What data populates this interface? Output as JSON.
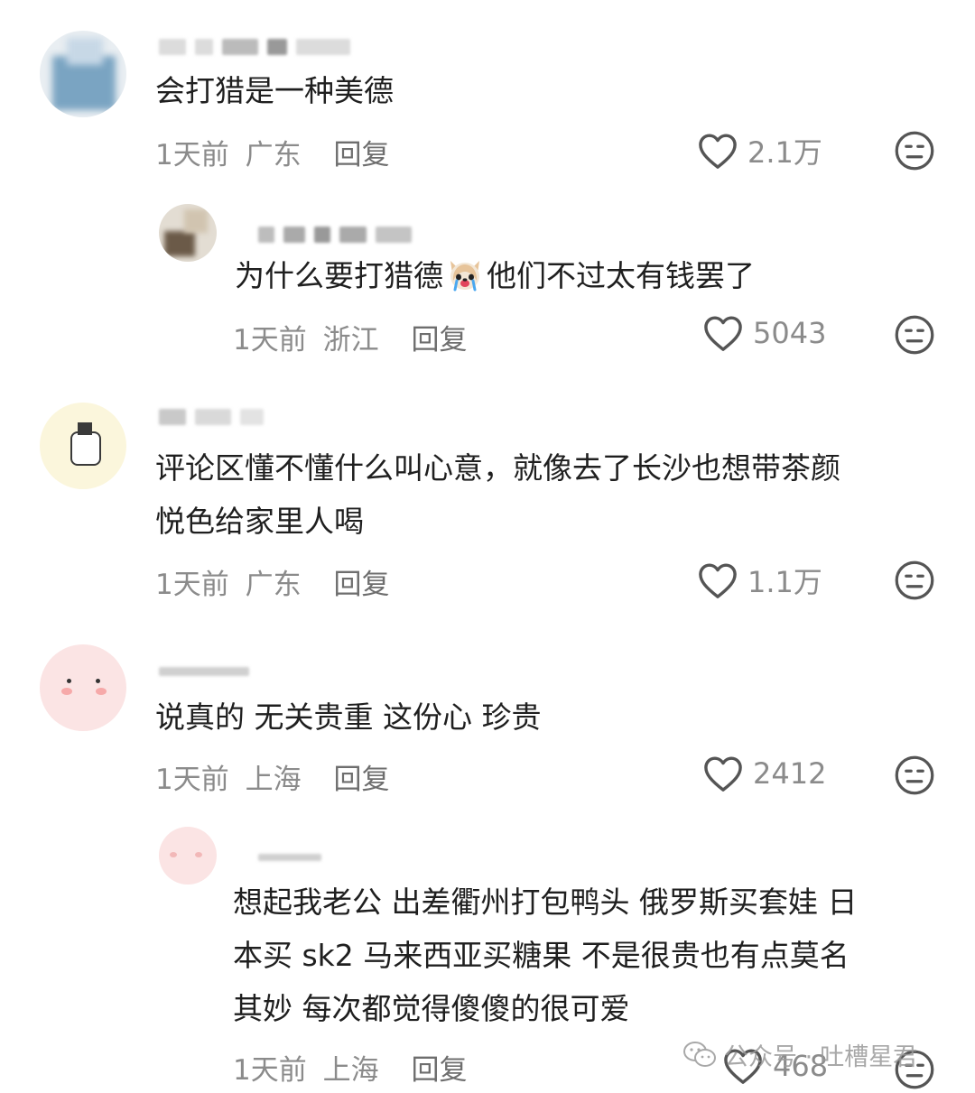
{
  "comments": [
    {
      "text": "会打猎是一种美德",
      "time": "1天前",
      "location": "广东",
      "reply_label": "回复",
      "likes": "2.1万",
      "avatar_colors": [
        "#c7d8e6",
        "#7aa4c2",
        "#e9eef2"
      ]
    },
    {
      "text_before_emoji": "为什么要打猎德",
      "emoji": "crying-dog-emoji",
      "text_after_emoji": "他们不过太有钱罢了",
      "time": "1天前",
      "location": "浙江",
      "reply_label": "回复",
      "likes": "5043",
      "avatar_colors": [
        "#6b5a48",
        "#e3ddd3",
        "#2d2d2d"
      ]
    },
    {
      "text_lines": [
        "评论区懂不懂什么叫心意，就像去了长沙也想带茶颜",
        "悦色给家里人喝"
      ],
      "time": "1天前",
      "location": "广东",
      "reply_label": "回复",
      "likes": "1.1万",
      "avatar_colors": [
        "#fbf6dc",
        "#3a3a3a"
      ]
    },
    {
      "text": "说真的 无关贵重 这份心 珍贵",
      "time": "1天前",
      "location": "上海",
      "reply_label": "回复",
      "likes": "2412",
      "avatar_colors": [
        "#fbe4e4",
        "#f6a9a9"
      ]
    },
    {
      "text_lines": [
        "想起我老公 出差衢州打包鸭头 俄罗斯买套娃 日",
        "本买 sk2 马来西亚买糖果 不是很贵也有点莫名",
        "其妙 每次都觉得傻傻的很可爱"
      ],
      "time": "1天前",
      "location": "上海",
      "reply_label": "回复",
      "likes": "468",
      "avatar_colors": [
        "#fbe4e4",
        "#f2b8b8"
      ]
    }
  ],
  "watermark": {
    "prefix": "公众号 ·",
    "name": "吐槽星君",
    "icon": "wechat-icon"
  },
  "icons": {
    "like": "heart-outline-icon",
    "dislike": "meh-face-icon"
  },
  "colors": {
    "text": "#1f1f1f",
    "meta": "#8b8b8b",
    "icon": "#555555"
  }
}
